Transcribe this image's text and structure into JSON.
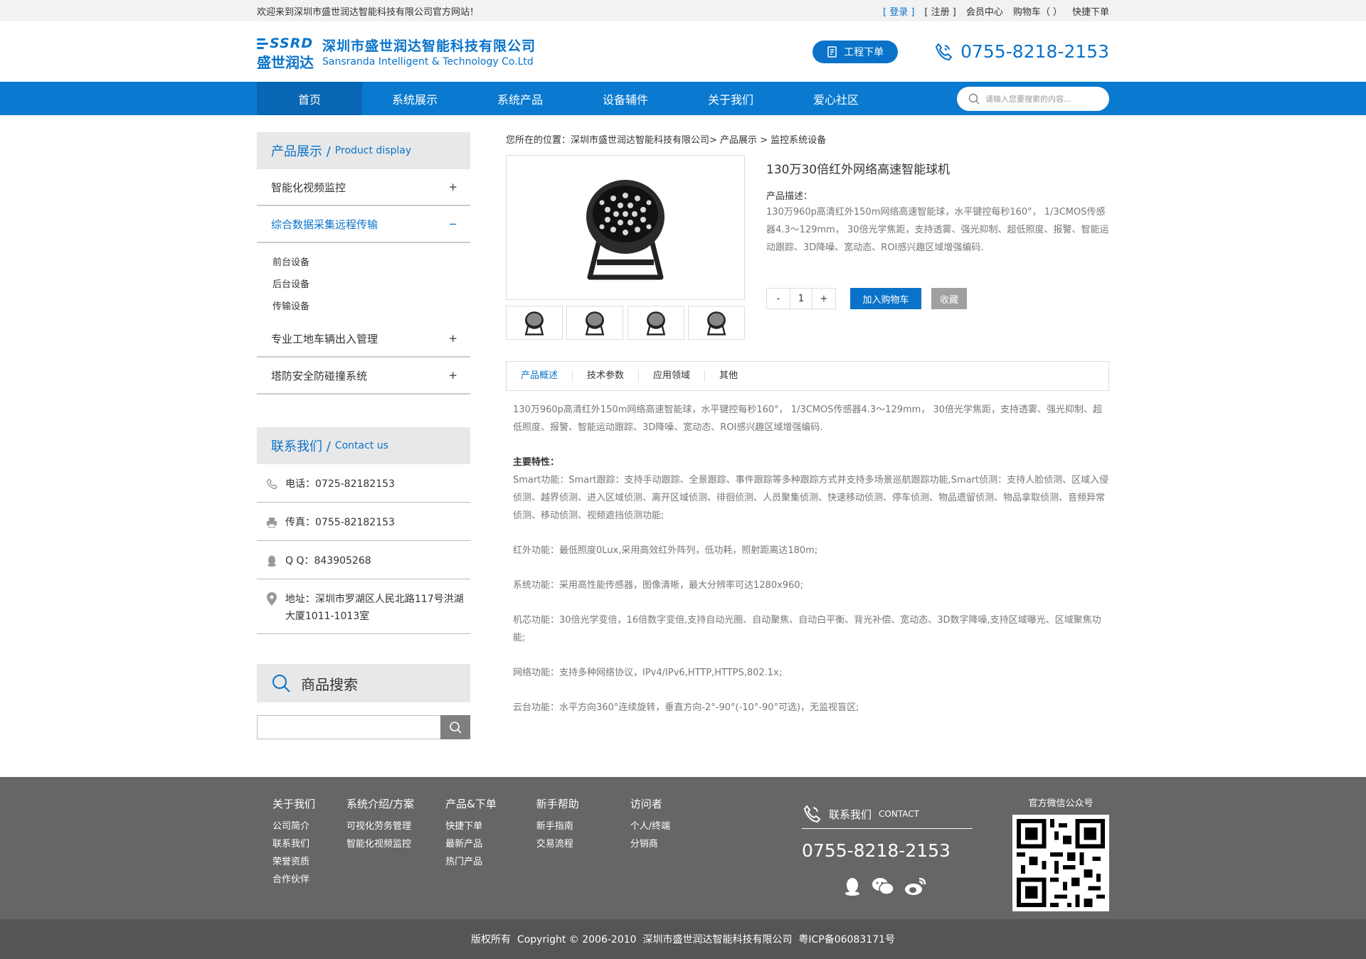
{
  "topbar": {
    "welcome": "欢迎来到深圳市盛世润达智能科技有限公司官方网站！",
    "login": "[ 登录 ]",
    "register": "[ 注册 ]",
    "member": "会员中心",
    "cart": "购物车（ ）",
    "quick_order": "快捷下单"
  },
  "header": {
    "logo_mark_en": "SSRD",
    "logo_mark_cn": "盛世润达",
    "company_cn": "深圳市盛世润达智能科技有限公司",
    "company_en": "Sansranda Intelligent & Technology Co.Ltd",
    "order_button": "工程下单",
    "phone": "0755-8218-2153"
  },
  "nav": {
    "items": [
      "首页",
      "系统展示",
      "系统产品",
      "设备辅件",
      "关于我们",
      "爱心社区"
    ],
    "search_placeholder": "请输入您要搜索的内容..."
  },
  "sidebar": {
    "product_title": "产品展示 /",
    "product_title_en": "Product display",
    "categories": [
      {
        "label": "智能化视频监控",
        "toggle": "+"
      },
      {
        "label": "综合数据采集远程传输",
        "toggle": "−"
      },
      {
        "label": "专业工地车辆出入管理",
        "toggle": "+"
      },
      {
        "label": "塔防安全防碰撞系统",
        "toggle": "+"
      }
    ],
    "subcategories": [
      "前台设备",
      "后台设备",
      "传输设备"
    ],
    "contact_title": "联系我们 /",
    "contact_title_en": "Contact us",
    "contacts": {
      "tel": "电话：0725-82182153",
      "fax": "传真：0755-82182153",
      "qq": "Q Q：843905268",
      "address": "地址：深圳市罗湖区人民北路117号洪湖大厦1011-1013室"
    },
    "search_title": "商品搜索"
  },
  "content": {
    "breadcrumb": "您所在的位置：深圳市盛世润达智能科技有限公司> 产品展示 > 监控系统设备",
    "product_title": "130万30倍红外网络高速智能球机",
    "desc_label": "产品描述：",
    "desc": "130万960p高清红外150m网络高速智能球，水平键控每秒160°， 1/3CMOS传感器4.3～129mm， 30倍光学焦距，支持透雾、强光抑制、超低照度、报警、智能运动跟踪、3D降噪、宽动态、ROI感兴趣区域增强编码.",
    "qty_minus": "-",
    "qty_value": "1",
    "qty_plus": "+",
    "add_cart": "加入购物车",
    "favorite": "收藏",
    "tabs": [
      "产品概述",
      "技术参数",
      "应用领域",
      "其他"
    ],
    "overview": " 130万960p高清红外150m网络高速智能球，水平键控每秒160°， 1/3CMOS传感器4.3～129mm， 30倍光学焦距，支持透雾、强光抑制、超低照度、报警、智能运动跟踪、3D降噪、宽动态、ROI感兴趣区域增强编码.",
    "features_label": "主要特性：",
    "smart": "Smart功能：Smart跟踪：支持手动跟踪、全景跟踪、事件跟踪等多种跟踪方式并支持多场景巡航跟踪功能,Smart侦测：支持人脸侦测、区域入侵侦测、越界侦测、进入区域侦测、离开区域侦测、徘徊侦测、人员聚集侦测、快速移动侦测、停车侦测、物品遗留侦测、物品拿取侦测、音频异常侦测、移动侦测、视频遮挡侦测功能;",
    "infrared": "红外功能：最低照度0Lux,采用高效红外阵列，低功耗，照射距离达180m;",
    "system": "系统功能：采用高性能传感器，图像清晰，最大分辨率可达1280x960;",
    "movement": "机芯功能：30倍光学变倍，16倍数字变倍,支持自动光圈、自动聚焦、自动白平衡、背光补偿、宽动态、3D数字降噪,支持区域曝光、区域聚焦功能;",
    "network": "网络功能：支持多种网络协议，IPv4/IPv6,HTTP,HTTPS,802.1x;",
    "ptz": "云台功能：水平方向360°连续旋转，垂直方向-2°-90°(-10°-90°可选)，无监视盲区;"
  },
  "footer": {
    "columns": [
      {
        "title": "关于我们",
        "links": [
          "公司简介",
          "联系我们",
          "荣誉资质",
          "合作伙伴"
        ]
      },
      {
        "title": "系统介绍/方案",
        "links": [
          "可视化劳务管理",
          "智能化视频监控"
        ]
      },
      {
        "title": "产品&下单",
        "links": [
          "快捷下单",
          "最新产品",
          "热门产品"
        ]
      },
      {
        "title": "新手帮助",
        "links": [
          "新手指南",
          "交易流程"
        ]
      },
      {
        "title": "访问者",
        "links": [
          "个人/终端",
          "分销商"
        ]
      }
    ],
    "contact_title": "联系我们",
    "contact_en": "CONTACT",
    "phone": "0755-8218-2153",
    "qr_title": "官方微信公众号",
    "copyright": "版权所有  Copyright © 2006-2010  深圳市盛世润达智能科技有限公司  粤ICP备06083171号"
  },
  "colors": {
    "brand": "#0a73c9",
    "nav": "#0a7ad0",
    "footer": "#666666"
  }
}
